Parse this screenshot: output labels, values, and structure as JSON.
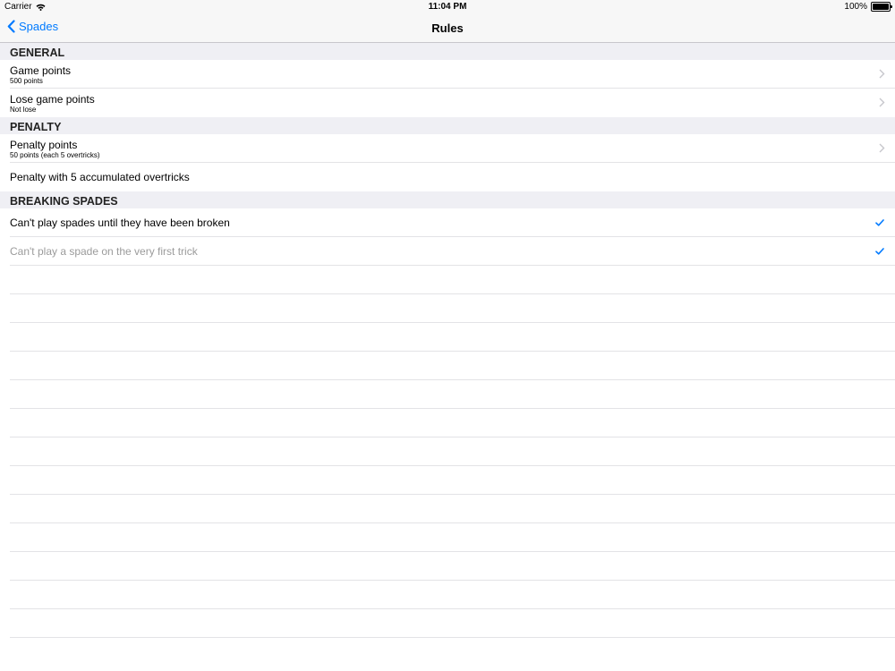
{
  "status_bar": {
    "carrier": "Carrier",
    "time": "11:04 PM",
    "battery": "100%",
    "battery_level": 1.0
  },
  "nav": {
    "back_label": "Spades",
    "title": "Rules"
  },
  "sections": [
    {
      "header": "GENERAL",
      "rows": [
        {
          "title": "Game points",
          "subtitle": "500 points",
          "accessory": "chevron-icon"
        },
        {
          "title": "Lose game points",
          "subtitle": "Not lose",
          "accessory": "chevron-icon"
        }
      ]
    },
    {
      "header": "PENALTY",
      "rows": [
        {
          "title": "Penalty points",
          "subtitle": "50 points (each 5 overtricks)",
          "accessory": "chevron-icon"
        },
        {
          "title": "Penalty with 5 accumulated overtricks"
        }
      ]
    },
    {
      "header": "BREAKING SPADES",
      "rows": [
        {
          "title": "Can't play spades until they have been broken",
          "accessory": "checkmark-icon",
          "checked": true
        },
        {
          "title": "Can't play a spade on the very first trick",
          "accessory": "checkmark-icon",
          "checked": true,
          "disabled": true
        }
      ]
    }
  ],
  "colors": {
    "accent": "#007aff",
    "section_background": "#efeff4",
    "separator": "#e3e3e6",
    "disabled_text": "#9b9b9b",
    "chevron": "#c7c7cc"
  }
}
